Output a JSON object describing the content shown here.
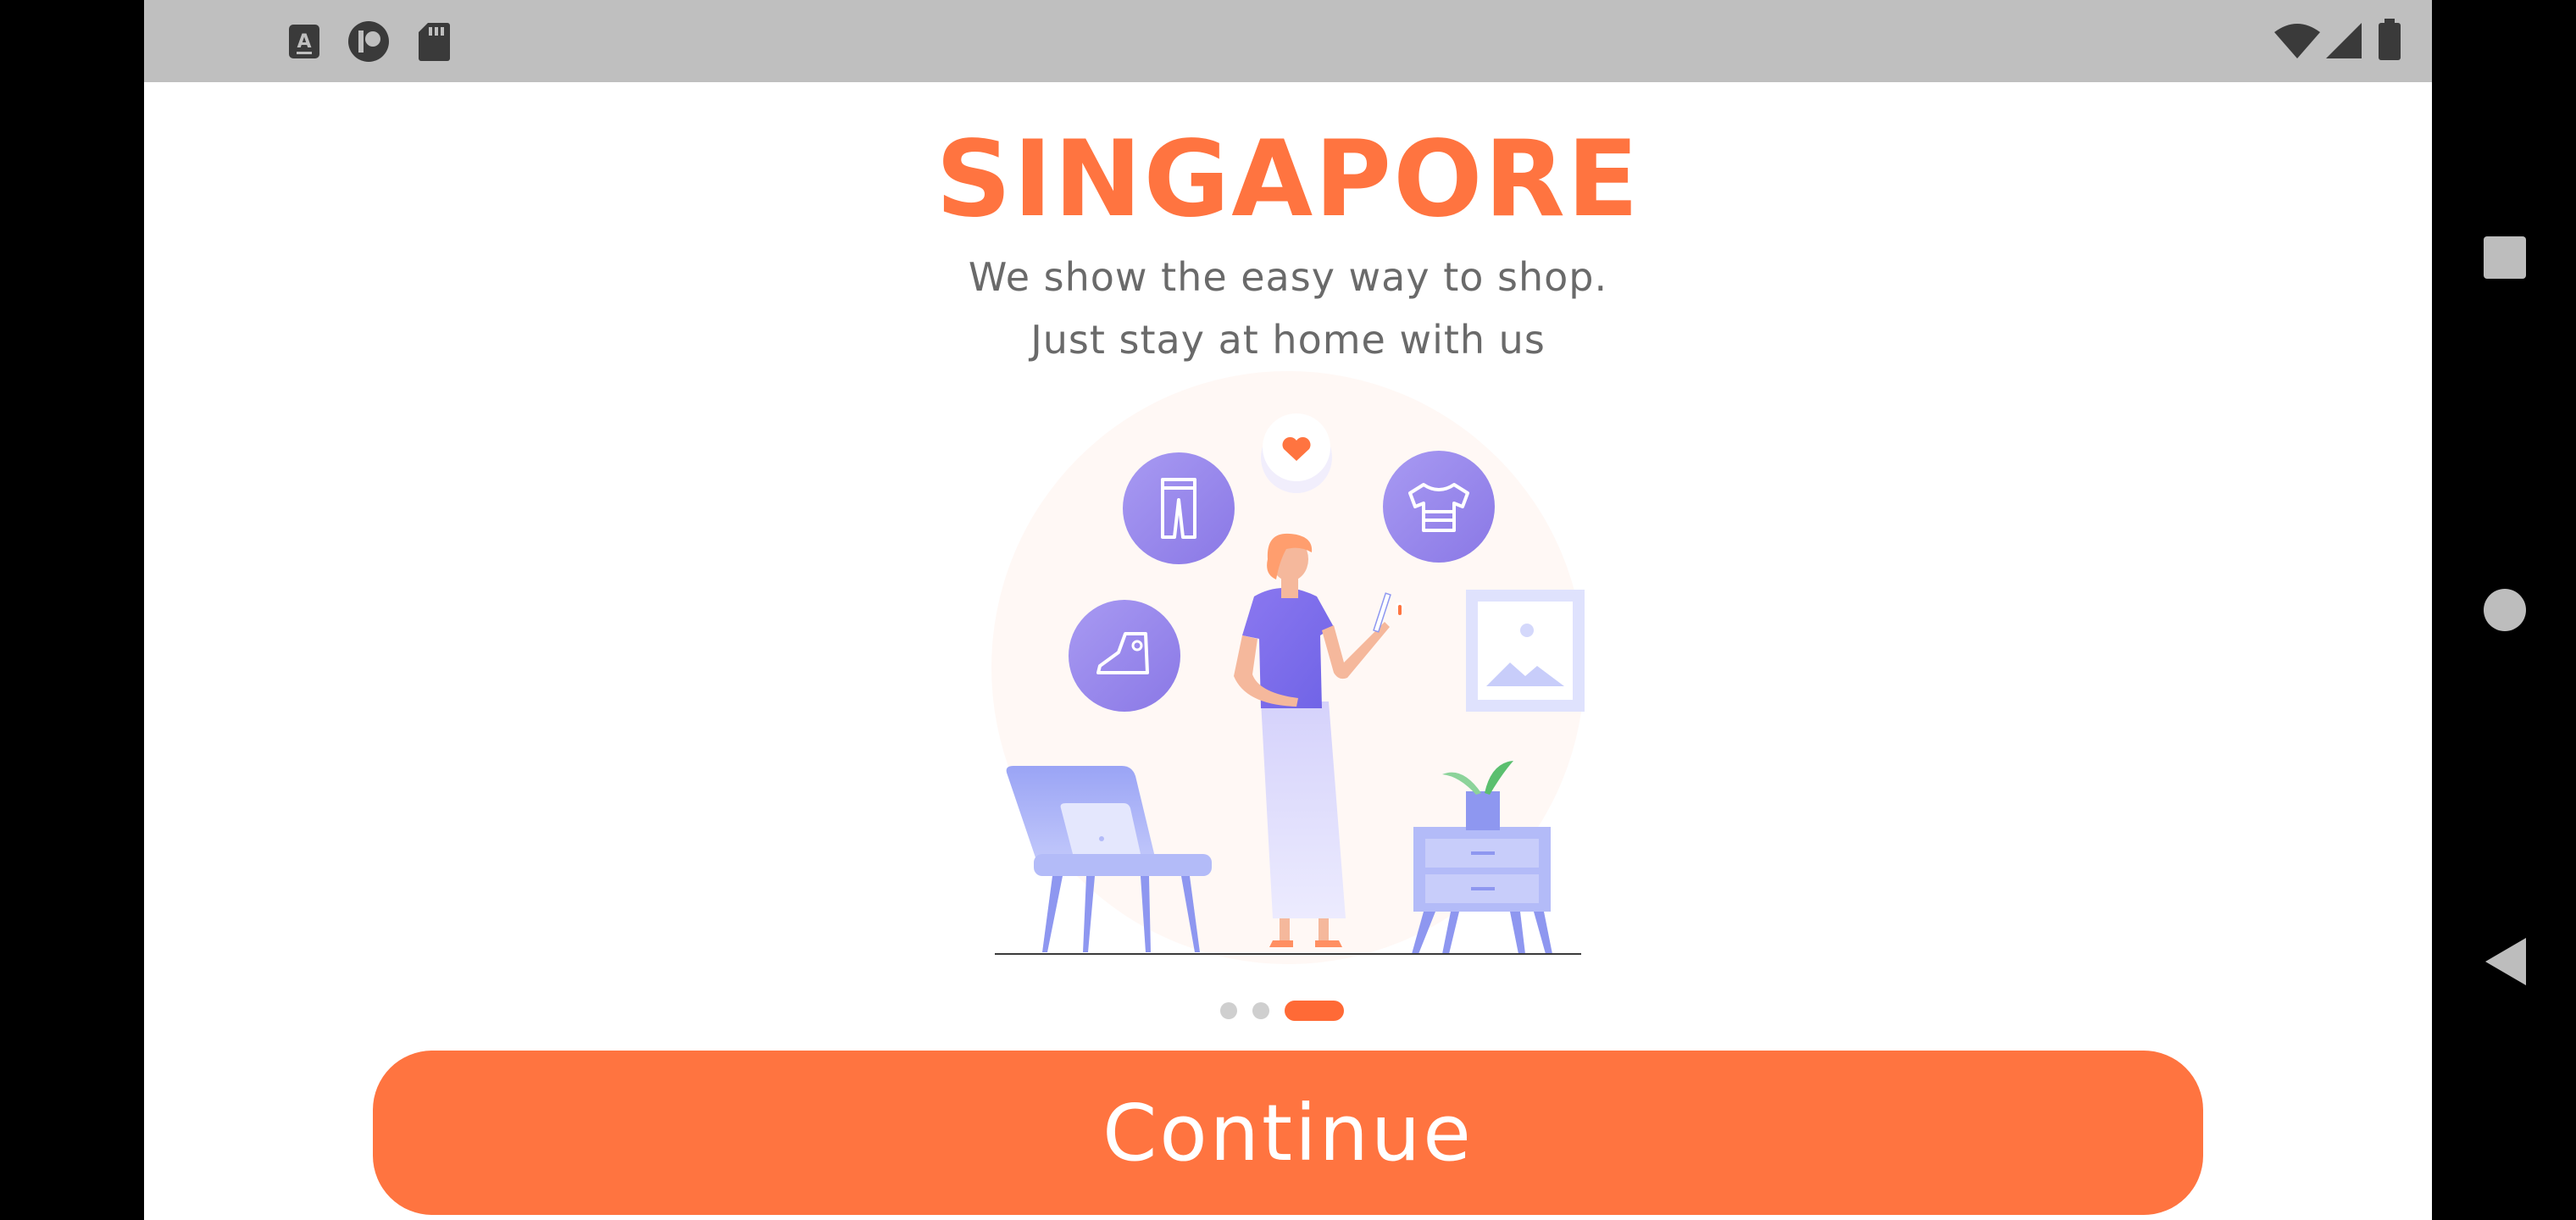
{
  "onboarding": {
    "title": "SINGAPORE",
    "subtitle_line1": "We show the easy way to shop.",
    "subtitle_line2": "Just stay at home with us",
    "continue_label": "Continue",
    "page_indicator": {
      "total": 3,
      "current": 3
    }
  },
  "status_bar": {
    "left_icons": [
      "text-a-icon",
      "record-icon",
      "sd-card-icon"
    ],
    "right_icons": [
      "wifi-icon",
      "signal-icon",
      "battery-icon"
    ]
  },
  "nav_bar": {
    "icons": [
      "recents-square-icon",
      "home-circle-icon",
      "back-triangle-icon"
    ]
  },
  "colors": {
    "accent": "#ff7440",
    "status_bar": "#bfbfbf",
    "text_gray": "#6a6a6a",
    "illustration_purple": "#8f7ee8"
  }
}
